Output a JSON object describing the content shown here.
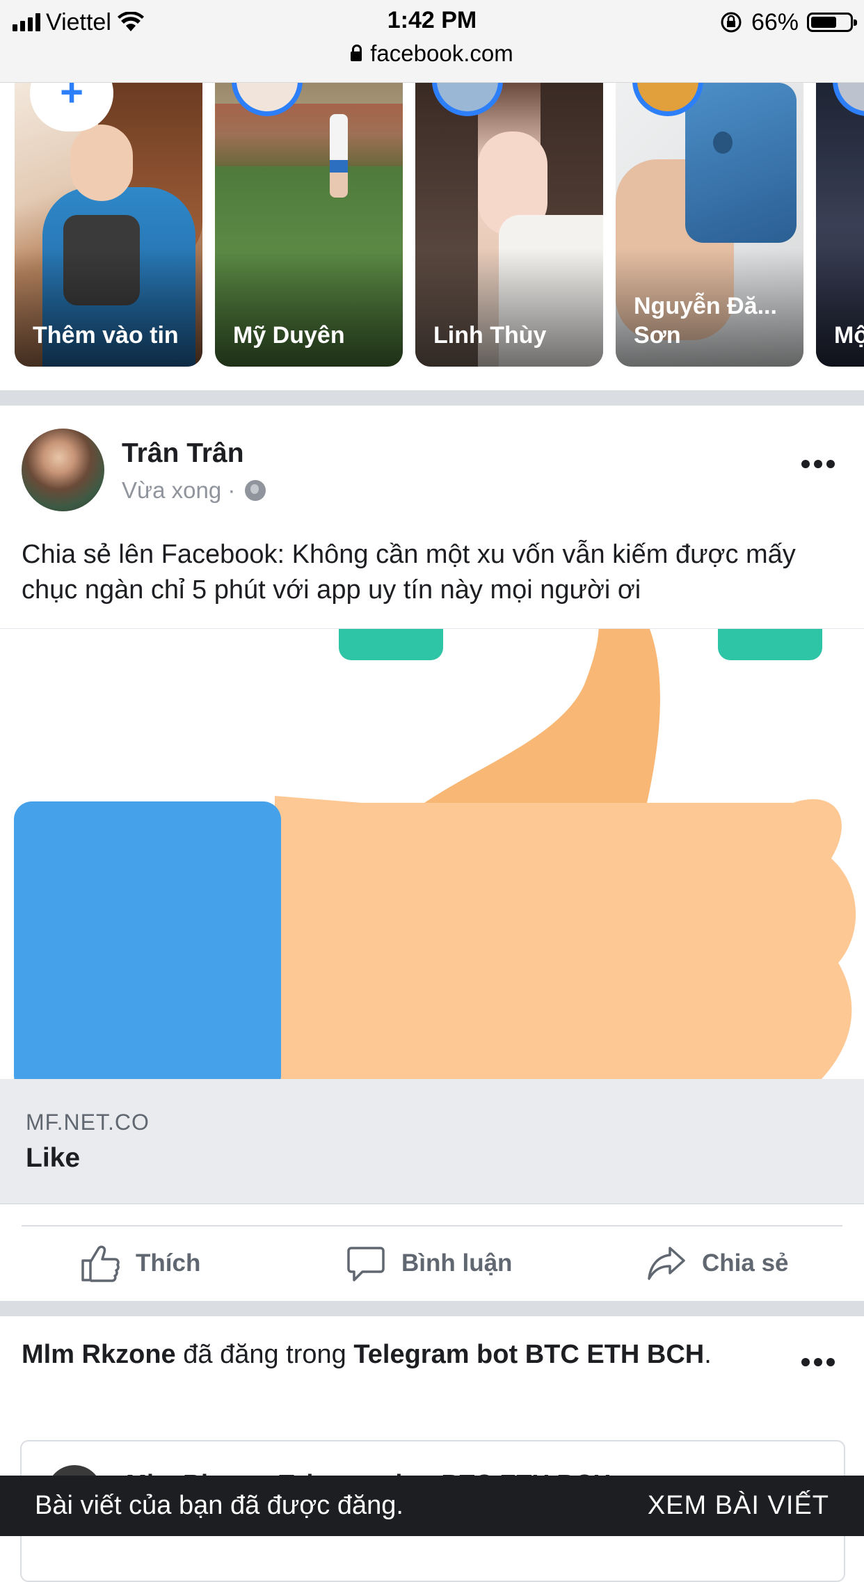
{
  "status_bar": {
    "carrier": "Viettel",
    "time": "1:42 PM",
    "battery_percent": "66%",
    "battery_level": 0.66,
    "url": "facebook.com"
  },
  "stories": [
    {
      "label": "Thêm vào tin",
      "type": "add"
    },
    {
      "label": "Mỹ Duyên"
    },
    {
      "label": "Linh Thùy"
    },
    {
      "label": "Nguyễn Đă... Sơn"
    },
    {
      "label": "Mộ Th"
    }
  ],
  "post": {
    "author": "Trân Trân",
    "time": "Vừa xong ·",
    "text": "Chia sẻ lên Facebook: Không cần một xu vốn vẫn kiếm được mấy chục ngàn chỉ 5 phút với app uy tín này mọi người ơi",
    "link_domain": "MF.NET.CO",
    "link_title": "Like",
    "actions": {
      "like": "Thích",
      "comment": "Bình luận",
      "share": "Chia sẻ"
    }
  },
  "post2": {
    "author": "Mlm Rkzone",
    "connector": " đã đăng trong ",
    "group": "Telegram bot BTC ETH BCH",
    "end": ".",
    "shared_name": "Mlm Rkzone Telegram bot BTC ETH BCH"
  },
  "toast": {
    "message": "Bài viết của bạn đã được đăng.",
    "action": "XEM BÀI VIẾT"
  },
  "colors": {
    "accent": "#2d7ff9",
    "thumb_blue": "#45a1ea",
    "thumb_skin": "#fdc894",
    "thumb_skin_dark": "#f8b774",
    "thumb_teal": "#2ec4a6"
  }
}
